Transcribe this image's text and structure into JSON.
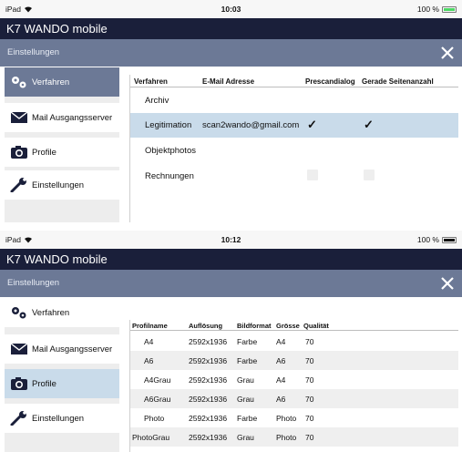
{
  "colors": {
    "appbar": "#1a1f3a",
    "titlebar": "#6c7996",
    "selected_light": "#c9dbea",
    "battery_green": "#4cd964",
    "battery_dark": "#111111"
  },
  "screens": [
    {
      "status": {
        "device": "iPad",
        "time": "10:03",
        "battery": "100 %",
        "battery_color": "green"
      },
      "app_title": "K7 WANDO mobile",
      "page_title": "Einstellungen",
      "sidebar": [
        {
          "label": "Verfahren",
          "icon": "gears-icon",
          "selected": true
        },
        {
          "label": "Mail Ausgangsserver",
          "icon": "mail-icon",
          "selected": false
        },
        {
          "label": "Profile",
          "icon": "camera-icon",
          "selected": false
        },
        {
          "label": "Einstellungen",
          "icon": "wrench-icon",
          "selected": false
        }
      ],
      "table": {
        "headers": [
          "Verfahren",
          "E-Mail Adresse",
          "Prescandialog",
          "Gerade Seitenanzahl"
        ],
        "rows": [
          {
            "verfahren": "Archiv",
            "email": "",
            "prescandialog": null,
            "gerade": null
          },
          {
            "verfahren": "Legitimation",
            "email": "scan2wando@gmail.com",
            "prescandialog": true,
            "gerade": true
          },
          {
            "verfahren": "Objektphotos",
            "email": "",
            "prescandialog": null,
            "gerade": null
          },
          {
            "verfahren": "Rechnungen",
            "email": "",
            "prescandialog": false,
            "gerade": false
          }
        ],
        "check_glyph": "✓"
      }
    },
    {
      "status": {
        "device": "iPad",
        "time": "10:12",
        "battery": "100 %",
        "battery_color": "dark"
      },
      "app_title": "K7 WANDO mobile",
      "page_title": "Einstellungen",
      "sidebar": [
        {
          "label": "Verfahren",
          "icon": "gears-icon",
          "selected": false
        },
        {
          "label": "Mail Ausgangsserver",
          "icon": "mail-icon",
          "selected": false
        },
        {
          "label": "Profile",
          "icon": "camera-icon",
          "selected": true
        },
        {
          "label": "Einstellungen",
          "icon": "wrench-icon",
          "selected": false
        }
      ],
      "table": {
        "headers": [
          "Profilname",
          "Auflösung",
          "Bildformat",
          "Grösse",
          "Qualität"
        ],
        "rows": [
          {
            "name": "A4",
            "aufloesung": "2592x1936",
            "bildformat": "Farbe",
            "groesse": "A4",
            "qualitaet": "70"
          },
          {
            "name": "A6",
            "aufloesung": "2592x1936",
            "bildformat": "Farbe",
            "groesse": "A6",
            "qualitaet": "70"
          },
          {
            "name": "A4Grau",
            "aufloesung": "2592x1936",
            "bildformat": "Grau",
            "groesse": "A4",
            "qualitaet": "70"
          },
          {
            "name": "A6Grau",
            "aufloesung": "2592x1936",
            "bildformat": "Grau",
            "groesse": "A6",
            "qualitaet": "70"
          },
          {
            "name": "Photo",
            "aufloesung": "2592x1936",
            "bildformat": "Farbe",
            "groesse": "Photo",
            "qualitaet": "70"
          },
          {
            "name": "PhotoGrau",
            "aufloesung": "2592x1936",
            "bildformat": "Grau",
            "groesse": "Photo",
            "qualitaet": "70"
          }
        ]
      }
    }
  ]
}
